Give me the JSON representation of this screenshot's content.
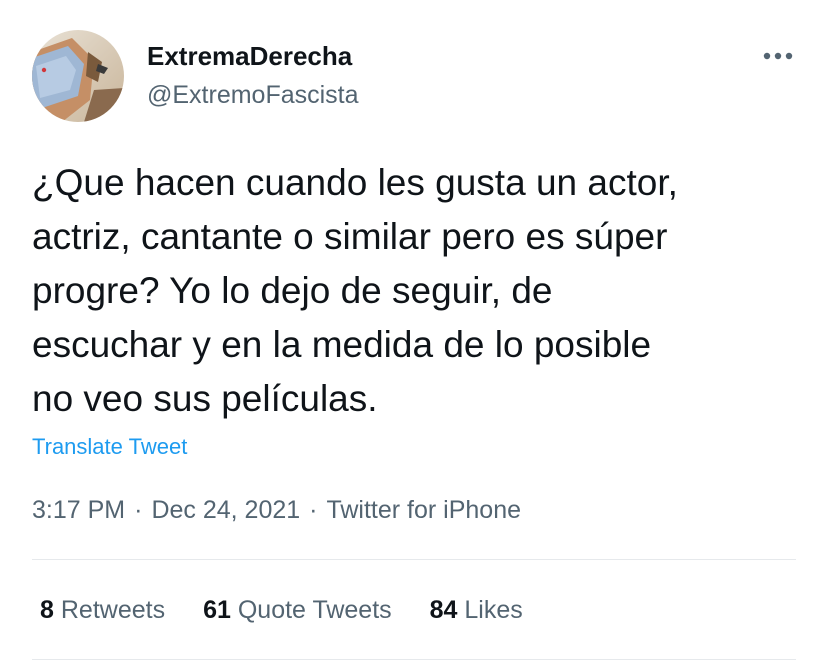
{
  "author": {
    "display_name": "ExtremaDerecha",
    "handle": "@ExtremoFascista",
    "avatar_icon": "profile-photo-avatar"
  },
  "more_icon": "more-options-dots-icon",
  "tweet": {
    "lines": [
      "¿Que hacen cuando les gusta un actor,",
      "actriz, cantante o similar pero es súper",
      "progre? Yo lo dejo de seguir, de",
      "escuchar y en la medida de lo posible",
      "no veo sus películas."
    ],
    "translate_label": "Translate Tweet",
    "time": "3:17 PM",
    "date": "Dec 24, 2021",
    "separator": "·",
    "source": "Twitter for iPhone"
  },
  "stats": {
    "retweets_count": "8",
    "retweets_label": "Retweets",
    "quotes_count": "61",
    "quotes_label": "Quote Tweets",
    "likes_count": "84",
    "likes_label": "Likes"
  },
  "colors": {
    "text": "#0f1419",
    "secondary": "#536471",
    "link": "#1d9bf0",
    "divider": "#e6e9ec"
  }
}
